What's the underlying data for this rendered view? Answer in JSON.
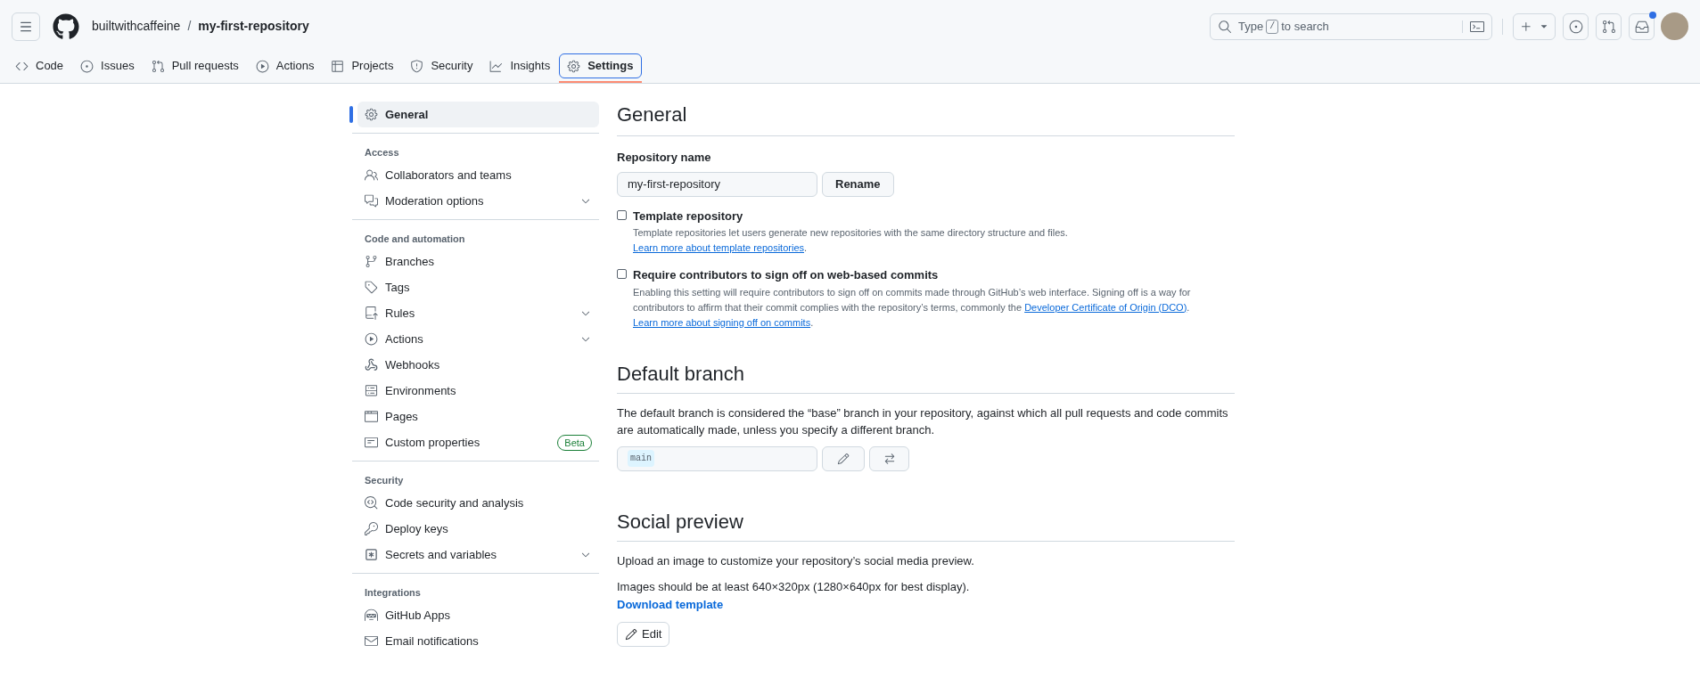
{
  "header": {
    "owner": "builtwithcaffeine",
    "separator": "/",
    "repo": "my-first-repository",
    "search": {
      "placeholder_before": "Type",
      "placeholder_key": "/",
      "placeholder_after": "to search"
    },
    "inbox_unread": true
  },
  "tabs": [
    {
      "label": "Code",
      "selected": false
    },
    {
      "label": "Issues",
      "selected": false
    },
    {
      "label": "Pull requests",
      "selected": false
    },
    {
      "label": "Actions",
      "selected": false
    },
    {
      "label": "Projects",
      "selected": false
    },
    {
      "label": "Security",
      "selected": false
    },
    {
      "label": "Insights",
      "selected": false
    },
    {
      "label": "Settings",
      "selected": true
    }
  ],
  "sidebar": {
    "groups": [
      {
        "items": [
          {
            "label": "General",
            "kind": "link",
            "selected": true
          }
        ]
      },
      {
        "heading": "Access",
        "items": [
          {
            "label": "Collaborators and teams",
            "kind": "link",
            "selected": false
          },
          {
            "label": "Moderation options",
            "kind": "submenu",
            "expanded": false,
            "selected": false
          }
        ]
      },
      {
        "heading": "Code and automation",
        "items": [
          {
            "label": "Branches",
            "kind": "link",
            "selected": false
          },
          {
            "label": "Tags",
            "kind": "link",
            "selected": false
          },
          {
            "label": "Rules",
            "kind": "submenu",
            "expanded": false,
            "selected": false
          },
          {
            "label": "Actions",
            "kind": "submenu",
            "expanded": false,
            "selected": false
          },
          {
            "label": "Webhooks",
            "kind": "link",
            "selected": false
          },
          {
            "label": "Environments",
            "kind": "link",
            "selected": false
          },
          {
            "label": "Pages",
            "kind": "link",
            "selected": false
          },
          {
            "label": "Custom properties",
            "kind": "link",
            "badge": "Beta",
            "selected": false
          }
        ]
      },
      {
        "heading": "Security",
        "items": [
          {
            "label": "Code security and analysis",
            "kind": "link",
            "selected": false
          },
          {
            "label": "Deploy keys",
            "kind": "link",
            "selected": false
          },
          {
            "label": "Secrets and variables",
            "kind": "submenu",
            "expanded": false,
            "selected": false
          }
        ]
      },
      {
        "heading": "Integrations",
        "items": [
          {
            "label": "GitHub Apps",
            "kind": "link",
            "selected": false
          },
          {
            "label": "Email notifications",
            "kind": "link",
            "selected": false
          }
        ]
      }
    ]
  },
  "general": {
    "title": "General",
    "repo_name_label": "Repository name",
    "repo_name_value": "my-first-repository",
    "rename_button": "Rename",
    "options": [
      {
        "label": "Template repository",
        "checked": false,
        "description": "Template repositories let users generate new repositories with the same directory structure and files.",
        "links": [
          "Learn more about template repositories"
        ],
        "after": [
          "."
        ]
      },
      {
        "label": "Require contributors to sign off on web-based commits",
        "checked": false,
        "description": "Enabling this setting will require contributors to sign off on commits made through GitHub’s web interface. Signing off is a way for contributors to affirm that their commit complies with the repository’s terms, commonly the",
        "links": [
          "Developer Certificate of Origin (DCO)",
          "Learn more about signing off on commits"
        ],
        "after": [
          ".",
          "."
        ]
      }
    ]
  },
  "default_branch": {
    "title": "Default branch",
    "description": "The default branch is considered the “base” branch in your repository, against which all pull requests and code commits are automatically made, unless you specify a different branch.",
    "branch": "main"
  },
  "social_preview": {
    "title": "Social preview",
    "description": "Upload an image to customize your repository’s social media preview.",
    "size_note": "Images should be at least 640×320px (1280×640px for best display).",
    "download_link": "Download template",
    "edit_button": "Edit"
  }
}
